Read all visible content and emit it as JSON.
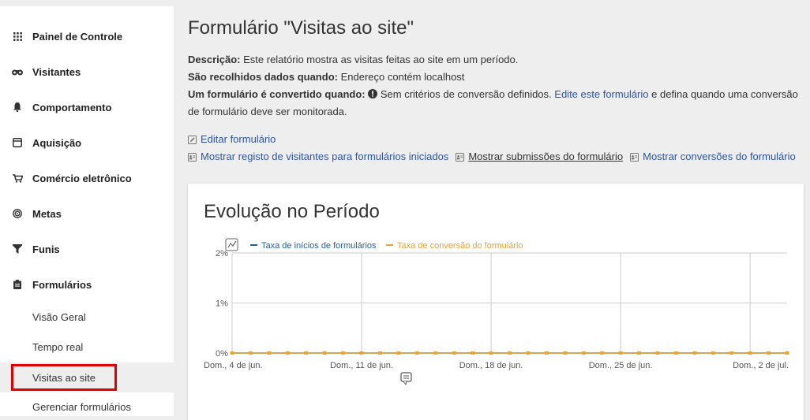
{
  "sidebar": {
    "items": [
      {
        "label": "Painel de Controle",
        "icon": "grid-icon"
      },
      {
        "label": "Visitantes",
        "icon": "binoculars-icon"
      },
      {
        "label": "Comportamento",
        "icon": "bell-icon"
      },
      {
        "label": "Aquisição",
        "icon": "window-icon"
      },
      {
        "label": "Comércio eletrônico",
        "icon": "cart-icon"
      },
      {
        "label": "Metas",
        "icon": "target-icon"
      },
      {
        "label": "Funis",
        "icon": "funnel-icon"
      },
      {
        "label": "Formulários",
        "icon": "clipboard-icon"
      }
    ],
    "subitems": [
      {
        "label": "Visão Geral"
      },
      {
        "label": "Tempo real"
      },
      {
        "label": "Visitas ao site"
      },
      {
        "label": "Gerenciar formulários"
      }
    ]
  },
  "main": {
    "title": "Formulário \"Visitas ao site\"",
    "description_label": "Descrição:",
    "description_text": "Este relatório mostra as visitas feitas ao site em um período.",
    "collected_label": "São recolhidos dados quando:",
    "collected_text": "Endereço contém localhost",
    "converted_label": "Um formulário é convertido quando:",
    "converted_text": "Sem critérios de conversão definidos.",
    "edit_link": "Edite este formulário",
    "converted_tail_1": "e defina quando uma conversão",
    "converted_tail_2": "de formulário deve ser monitorada.",
    "actions": {
      "edit": "Editar formulário",
      "show_visitor_log": "Mostrar registo de visitantes para formulários iniciados",
      "show_submissions": "Mostrar submissões do formulário",
      "show_conversions": "Mostrar conversões do formulário"
    }
  },
  "card": {
    "title": "Evolução no Período"
  },
  "colors": {
    "series1": "#1f5fa6",
    "series2": "#f0a130",
    "link": "#2d54a8",
    "highlight": "#e00000"
  },
  "chart_data": {
    "type": "line",
    "title": "",
    "x_tick_labels": [
      "Dom., 4 de jun.",
      "Dom., 11 de jun.",
      "Dom., 18 de jun.",
      "Dom., 25 de jun.",
      "Dom., 2 de jul."
    ],
    "y_tick_labels": [
      "2%",
      "1%",
      "0%"
    ],
    "ylim": [
      0,
      2
    ],
    "series": [
      {
        "name": "Taxa de inícios de formulários",
        "color": "#1f5fa6",
        "values": [
          0,
          0,
          0,
          0,
          0,
          0,
          0,
          0,
          0,
          0,
          0,
          0,
          0,
          0,
          0,
          0,
          0,
          0,
          0,
          0,
          0,
          0,
          0,
          0,
          0,
          0,
          0,
          0,
          0,
          0,
          0
        ]
      },
      {
        "name": "Taxa de conversão do formulário",
        "color": "#f0a130",
        "values": [
          0,
          0,
          0,
          0,
          0,
          0,
          0,
          0,
          0,
          0,
          0,
          0,
          0,
          0,
          0,
          0,
          0,
          0,
          0,
          0,
          0,
          0,
          0,
          0,
          0,
          0,
          0,
          0,
          0,
          0,
          0
        ]
      }
    ],
    "grid": true,
    "legend_position": "top-left"
  }
}
